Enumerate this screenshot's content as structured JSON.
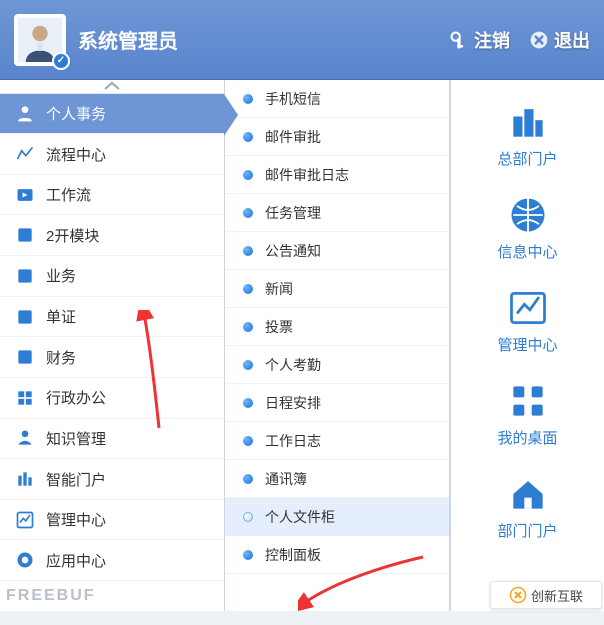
{
  "header": {
    "title": "系统管理员"
  },
  "top_actions": {
    "logout": "注销",
    "exit": "退出"
  },
  "sidebar": {
    "items": [
      {
        "label": "个人事务"
      },
      {
        "label": "流程中心"
      },
      {
        "label": "工作流"
      },
      {
        "label": "2开模块"
      },
      {
        "label": "业务"
      },
      {
        "label": "单证"
      },
      {
        "label": "财务"
      },
      {
        "label": "行政办公"
      },
      {
        "label": "知识管理"
      },
      {
        "label": "智能门户"
      },
      {
        "label": "管理中心"
      },
      {
        "label": "应用中心"
      }
    ]
  },
  "submenu": {
    "items": [
      "手机短信",
      "邮件审批",
      "邮件审批日志",
      "任务管理",
      "公告通知",
      "新闻",
      "投票",
      "个人考勤",
      "日程安排",
      "工作日志",
      "通讯簿",
      "个人文件柜",
      "控制面板"
    ]
  },
  "portal": {
    "items": [
      "总部门户",
      "信息中心",
      "管理中心",
      "我的桌面",
      "部门门户"
    ]
  },
  "watermark": "创新互联",
  "footer_brand": "FREEBUF"
}
